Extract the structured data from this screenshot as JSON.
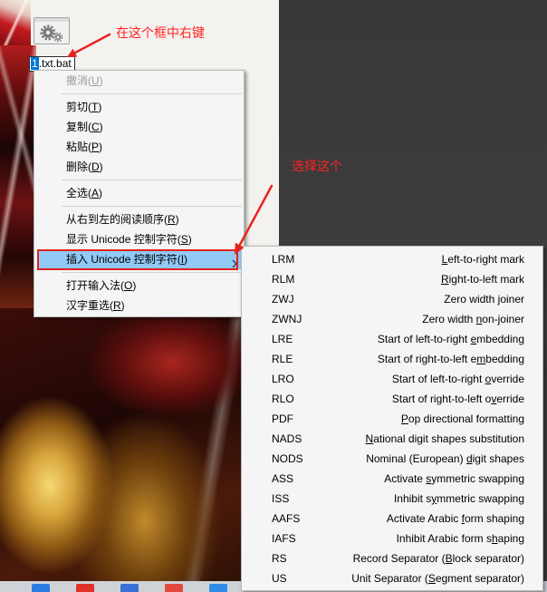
{
  "desktop": {
    "file_icon": "gear-icon",
    "file_name_selected": "1",
    "file_name_rest": ".txt.bat"
  },
  "annotations": {
    "right_click_hint": "在这个框中右键",
    "select_hint": "选择这个"
  },
  "context_menu": {
    "groups": [
      [
        {
          "label": "撤消(U)",
          "disabled": true
        }
      ],
      [
        {
          "label": "剪切(T)"
        },
        {
          "label": "复制(C)"
        },
        {
          "label": "粘贴(P)"
        },
        {
          "label": "删除(D)"
        }
      ],
      [
        {
          "label": "全选(A)"
        }
      ],
      [
        {
          "label": "从右到左的阅读顺序(R)"
        },
        {
          "label": "显示 Unicode 控制字符(S)"
        },
        {
          "label": "插入 Unicode 控制字符(I)",
          "highlighted": true,
          "submenu_icon": "chevron-right-icon"
        }
      ],
      [
        {
          "label": "打开输入法(O)"
        },
        {
          "label": "汉字重选(R)"
        }
      ]
    ]
  },
  "unicode_submenu": {
    "items": [
      {
        "code": "LRM",
        "description": "Left-to-right mark",
        "accel": 0
      },
      {
        "code": "RLM",
        "description": "Right-to-left mark",
        "accel": 0
      },
      {
        "code": "ZWJ",
        "description": "Zero width joiner",
        "accel": 11
      },
      {
        "code": "ZWNJ",
        "description": "Zero width non-joiner",
        "accel": 11
      },
      {
        "code": "LRE",
        "description": "Start of left-to-right embedding",
        "accel": 23
      },
      {
        "code": "RLE",
        "description": "Start of right-to-left embedding",
        "accel": 24
      },
      {
        "code": "LRO",
        "description": "Start of left-to-right override",
        "accel": 23
      },
      {
        "code": "RLO",
        "description": "Start of right-to-left override",
        "accel": 24
      },
      {
        "code": "PDF",
        "description": "Pop directional formatting",
        "accel": 0
      },
      {
        "code": "NADS",
        "description": "National digit shapes substitution",
        "accel": 0
      },
      {
        "code": "NODS",
        "description": "Nominal (European) digit shapes",
        "accel": 19
      },
      {
        "code": "ASS",
        "description": "Activate symmetric swapping",
        "accel": 9
      },
      {
        "code": "ISS",
        "description": "Inhibit symmetric swapping",
        "accel": 9
      },
      {
        "code": "AAFS",
        "description": "Activate Arabic form shaping",
        "accel": 16
      },
      {
        "code": "IAFS",
        "description": "Inhibit Arabic form shaping",
        "accel": 21
      },
      {
        "code": "RS",
        "description": "Record Separator (Block separator)",
        "accel": 18
      },
      {
        "code": "US",
        "description": "Unit Separator (Segment separator)",
        "accel": 16
      }
    ]
  },
  "taskbar": {
    "icons": [
      {
        "icon": "app-icon",
        "color": "#2b7de1"
      },
      {
        "icon": "app-icon",
        "color": "#e0312b"
      },
      {
        "icon": "app-icon",
        "color": "#3a6fd8"
      },
      {
        "icon": "app-icon",
        "color": "#e0493b"
      },
      {
        "icon": "app-icon",
        "color": "#2f8be6"
      }
    ]
  },
  "colors": {
    "annotation": "#ff2222",
    "menu_background": "#f5f5f5",
    "menu_highlight": "#91c9f7",
    "text_selection": "#0078d7",
    "desktop_background": "#3b3b3b"
  }
}
